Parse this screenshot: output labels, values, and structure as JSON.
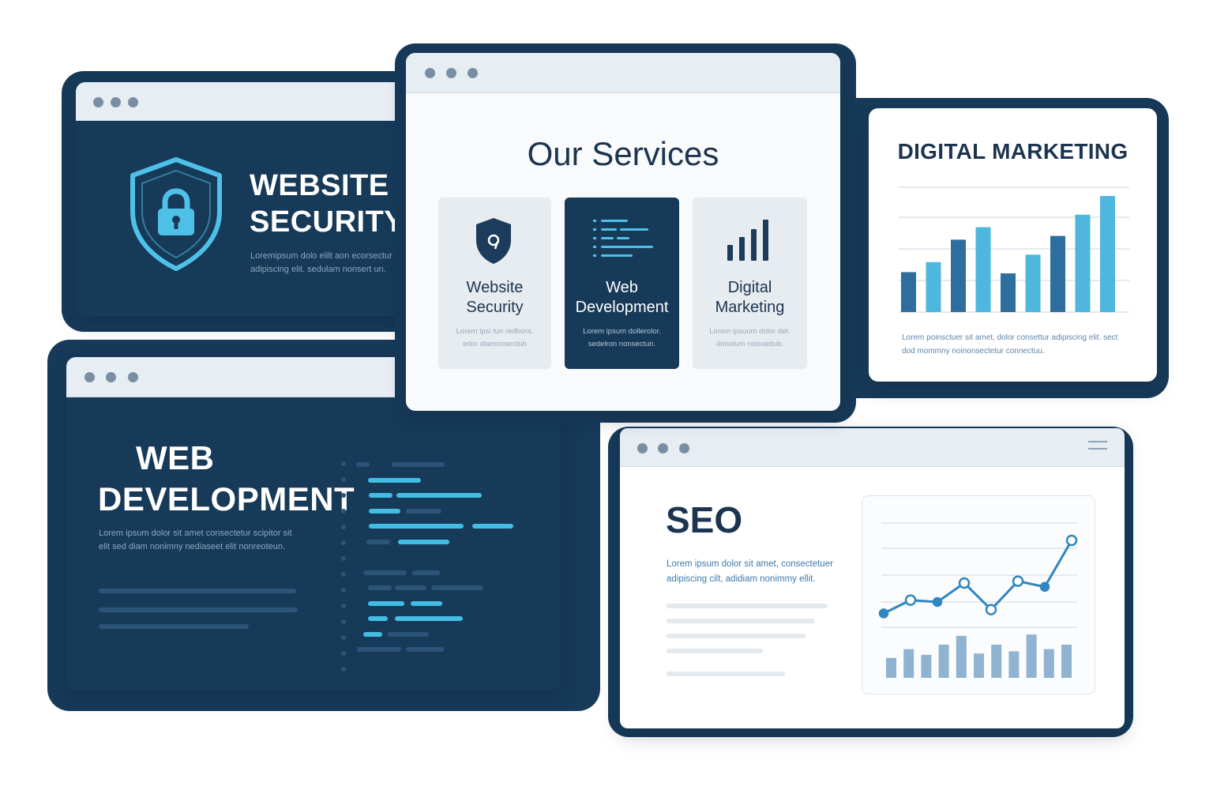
{
  "website_security": {
    "title_line1": "WEBSITE",
    "title_line2": "SECURITY",
    "desc_line1": "Loremipsum  dolo elilt aon ecorsectur",
    "desc_line2": "adipiscing elit. sedulam nonsert un.",
    "icon": "shield-lock-icon"
  },
  "services": {
    "heading": "Our Services",
    "cards": [
      {
        "label_line1": "Website",
        "label_line2": "Security",
        "desc_line1": "Lorem ipsi tun redbora.",
        "desc_line2": "edor diamonsectuh",
        "icon": "shield-icon"
      },
      {
        "label_line1": "Web",
        "label_line2": "Development",
        "desc_line1": "Lorem ipsum dollerolor.",
        "desc_line2": "sedelron nonsectun.",
        "icon": "code-lines-icon"
      },
      {
        "label_line1": "Digital",
        "label_line2": "Marketing",
        "desc_line1": "Lorem ipsuum dolor det.",
        "desc_line2": "donolum noissedub.",
        "icon": "bar-chart-icon"
      }
    ]
  },
  "digital_marketing": {
    "title": "DIGITAL MARKETING",
    "desc_line1": "Lorem poinsctuer sit amet, dolor consettur adipiscing elit. sect",
    "desc_line2": "dod mommny noinonsectetur  connectuu.",
    "chart_data": {
      "type": "bar",
      "values": [
        0.32,
        0.4,
        0.58,
        0.68,
        0.31,
        0.46,
        0.61,
        0.78,
        0.93
      ],
      "colors": [
        "#2e6e9e",
        "#4fb6dd",
        "#2e6e9e",
        "#4fb6dd",
        "#2e6e9e",
        "#4fb6dd",
        "#2e6e9e",
        "#4fb6dd",
        "#4fb6dd"
      ]
    }
  },
  "web_development": {
    "title_line1": "WEB",
    "title_line2": "DEVELOPMENT",
    "desc_line1": "Lorem ipsum dolor sit amet consectetur scipitor sit",
    "desc_line2": "elit sed diam nonimny nediaseet elit nonreoteun."
  },
  "seo": {
    "title": "SEO",
    "desc_line1": "Lorem ipsum dolor sit amet, consectetuer",
    "desc_line2": "adipiscing cilt, adidiam nonimmy ellit.",
    "chart_data": {
      "type": "line",
      "line_values": [
        0.18,
        0.32,
        0.3,
        0.5,
        0.22,
        0.52,
        0.46,
        0.95
      ],
      "bar_values": [
        0.45,
        0.65,
        0.52,
        0.75,
        0.95,
        0.55,
        0.75,
        0.6,
        0.98,
        0.65,
        0.75
      ]
    }
  }
}
